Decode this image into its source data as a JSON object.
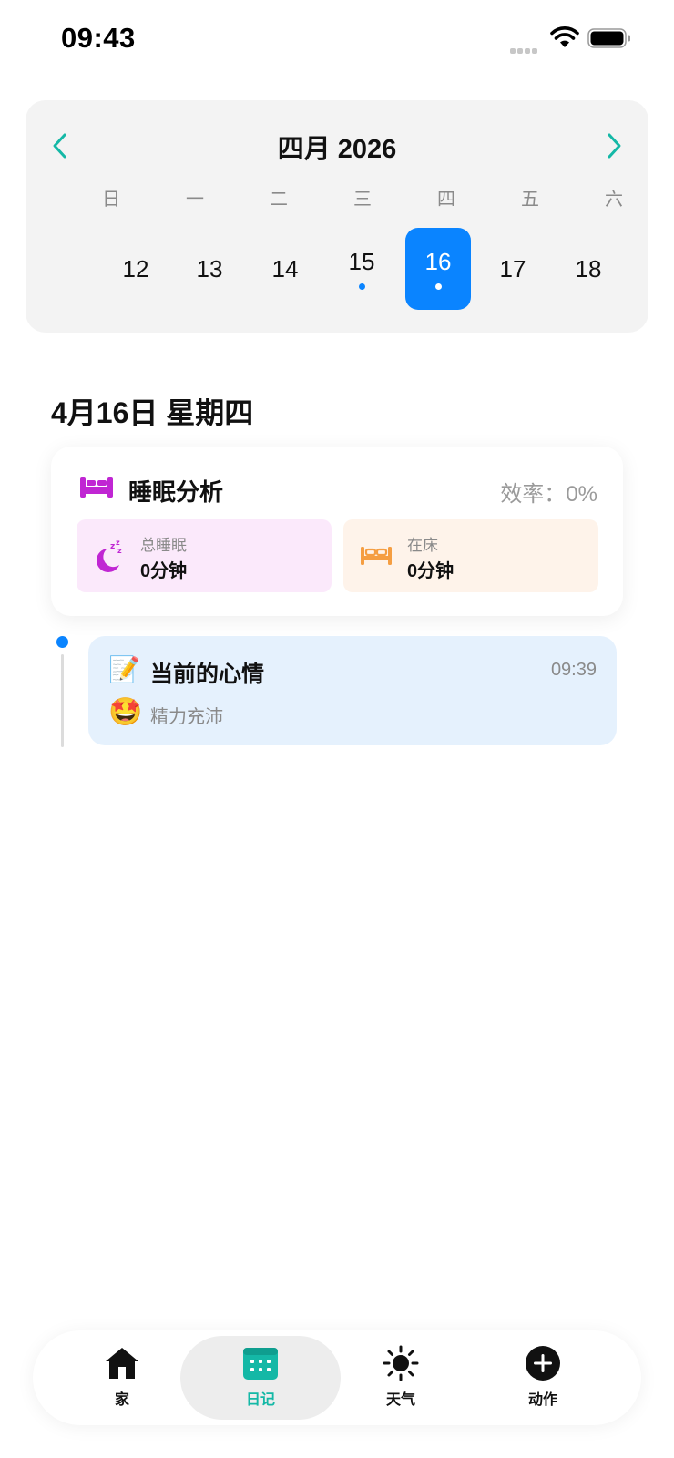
{
  "status_bar": {
    "time": "09:43"
  },
  "calendar": {
    "month_title": "四月 2026",
    "weekdays": [
      "日",
      "一",
      "二",
      "三",
      "四",
      "五",
      "六"
    ],
    "days": [
      {
        "num": "12",
        "has_entry": false,
        "selected": false
      },
      {
        "num": "13",
        "has_entry": false,
        "selected": false
      },
      {
        "num": "14",
        "has_entry": false,
        "selected": false
      },
      {
        "num": "15",
        "has_entry": true,
        "selected": false
      },
      {
        "num": "16",
        "has_entry": true,
        "selected": true
      },
      {
        "num": "17",
        "has_entry": false,
        "selected": false
      },
      {
        "num": "18",
        "has_entry": false,
        "selected": false
      }
    ],
    "accent_color": "#14b8a6",
    "selected_color": "#0a84ff"
  },
  "date_heading": "4月16日 星期四",
  "sleep": {
    "title": "睡眠分析",
    "efficiency_label": "效率：",
    "efficiency_value": "0%",
    "total_sleep_label": "总睡眠",
    "total_sleep_value": "0分钟",
    "in_bed_label": "在床",
    "in_bed_value": "0分钟",
    "icon": "bed-icon",
    "colors": {
      "purple": "#c026d3",
      "orange": "#f59e42"
    }
  },
  "entry": {
    "emoji": "📝",
    "title": "当前的心情",
    "time": "09:39",
    "mood_emoji": "🤩",
    "mood_text": "精力充沛"
  },
  "nav": {
    "items": [
      {
        "label": "家",
        "icon": "home-icon",
        "active": false
      },
      {
        "label": "日记",
        "icon": "calendar-icon",
        "active": true
      },
      {
        "label": "天气",
        "icon": "sun-icon",
        "active": false
      },
      {
        "label": "动作",
        "icon": "plus-circle-icon",
        "active": false
      }
    ],
    "active_color": "#14b8a6"
  }
}
